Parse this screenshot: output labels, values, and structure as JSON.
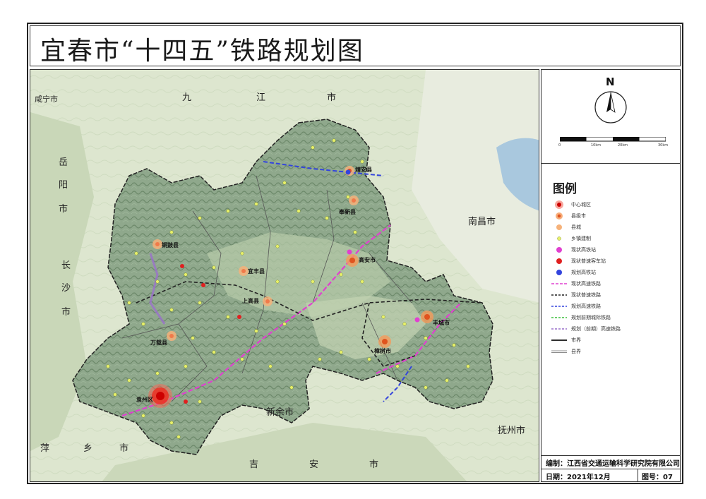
{
  "title": "宜春市“十四五”铁路规划图",
  "north": "N",
  "scale_labels": [
    "0",
    "10km",
    "20km",
    "30km"
  ],
  "legend": {
    "title": "图例",
    "items": [
      {
        "label": "中心城区",
        "icon": "center-city-icon"
      },
      {
        "label": "县级市",
        "icon": "county-city-icon"
      },
      {
        "label": "县城",
        "icon": "county-town-icon"
      },
      {
        "label": "乡镇建制",
        "icon": "township-icon"
      },
      {
        "label": "现状高铁站",
        "icon": "existing-hsr-station-icon"
      },
      {
        "label": "现状普速客车站",
        "icon": "existing-station-icon"
      },
      {
        "label": "规划高铁站",
        "icon": "planned-hsr-station-icon"
      },
      {
        "label": "现状高速铁路",
        "icon": "existing-hsr-line-icon"
      },
      {
        "label": "现状普速铁路",
        "icon": "existing-rail-line-icon"
      },
      {
        "label": "规划高速铁路",
        "icon": "planned-hsr-line-icon"
      },
      {
        "label": "规划前期城际铁路",
        "icon": "planned-intercity-line-icon"
      },
      {
        "label": "规划（前期）高速铁路",
        "icon": "planned-early-hsr-line-icon"
      },
      {
        "label": "市界",
        "icon": "city-boundary-icon"
      },
      {
        "label": "县界",
        "icon": "county-boundary-icon"
      }
    ]
  },
  "footer": {
    "compiler": "编制：江西省交通运输科学研究院有限公司",
    "date": "日期：2021年12月",
    "number": "图号：07"
  },
  "places": {
    "xianning": "咸宁市",
    "jiu": "九",
    "jiang": "江",
    "shi_jiujiang": "市",
    "yue": "岳",
    "yang": "阳",
    "shi_yueyang": "市",
    "chang": "长",
    "sha": "沙",
    "shi_changsha": "市",
    "nanchang": "南昌市",
    "xinyu": "新余市",
    "fuzhou": "抚州市",
    "ping": "萍",
    "xiang": "乡",
    "shi_pingxiang": "市",
    "ji": "吉",
    "an": "安",
    "shi_jian": "市",
    "jingan": "靖安县",
    "fengxin": "奉新县",
    "tonggu": "铜鼓县",
    "yifeng": "宜丰县",
    "gaoan": "高安市",
    "shanggao": "上高县",
    "wanzai": "万载县",
    "zhangshu": "樟树市",
    "fengcheng": "丰城市",
    "yuanzhou": "袁州区"
  }
}
